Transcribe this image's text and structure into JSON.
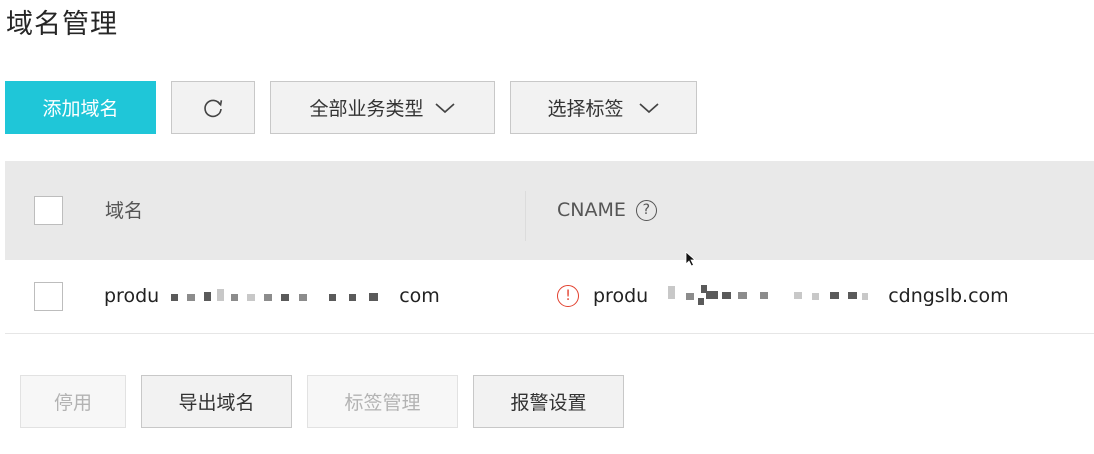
{
  "page": {
    "title": "域名管理"
  },
  "toolbar": {
    "add_domain": "添加域名",
    "refresh_icon": "refresh-icon",
    "business_type": "全部业务类型",
    "select_tag": "选择标签"
  },
  "table": {
    "columns": {
      "domain": "域名",
      "cname": "CNAME"
    },
    "help_icon_glyph": "?",
    "rows": [
      {
        "domain_prefix": "produ",
        "domain_suffix": "com",
        "cname_prefix": "produ",
        "cname_suffix": "cdngslb.com",
        "status_icon_glyph": "!"
      }
    ]
  },
  "actions": {
    "disable": "停用",
    "export": "导出域名",
    "tag_manage": "标签管理",
    "alert_settings": "报警设置"
  },
  "colors": {
    "primary": "#1fc6d8",
    "warning": "#e2402e"
  }
}
